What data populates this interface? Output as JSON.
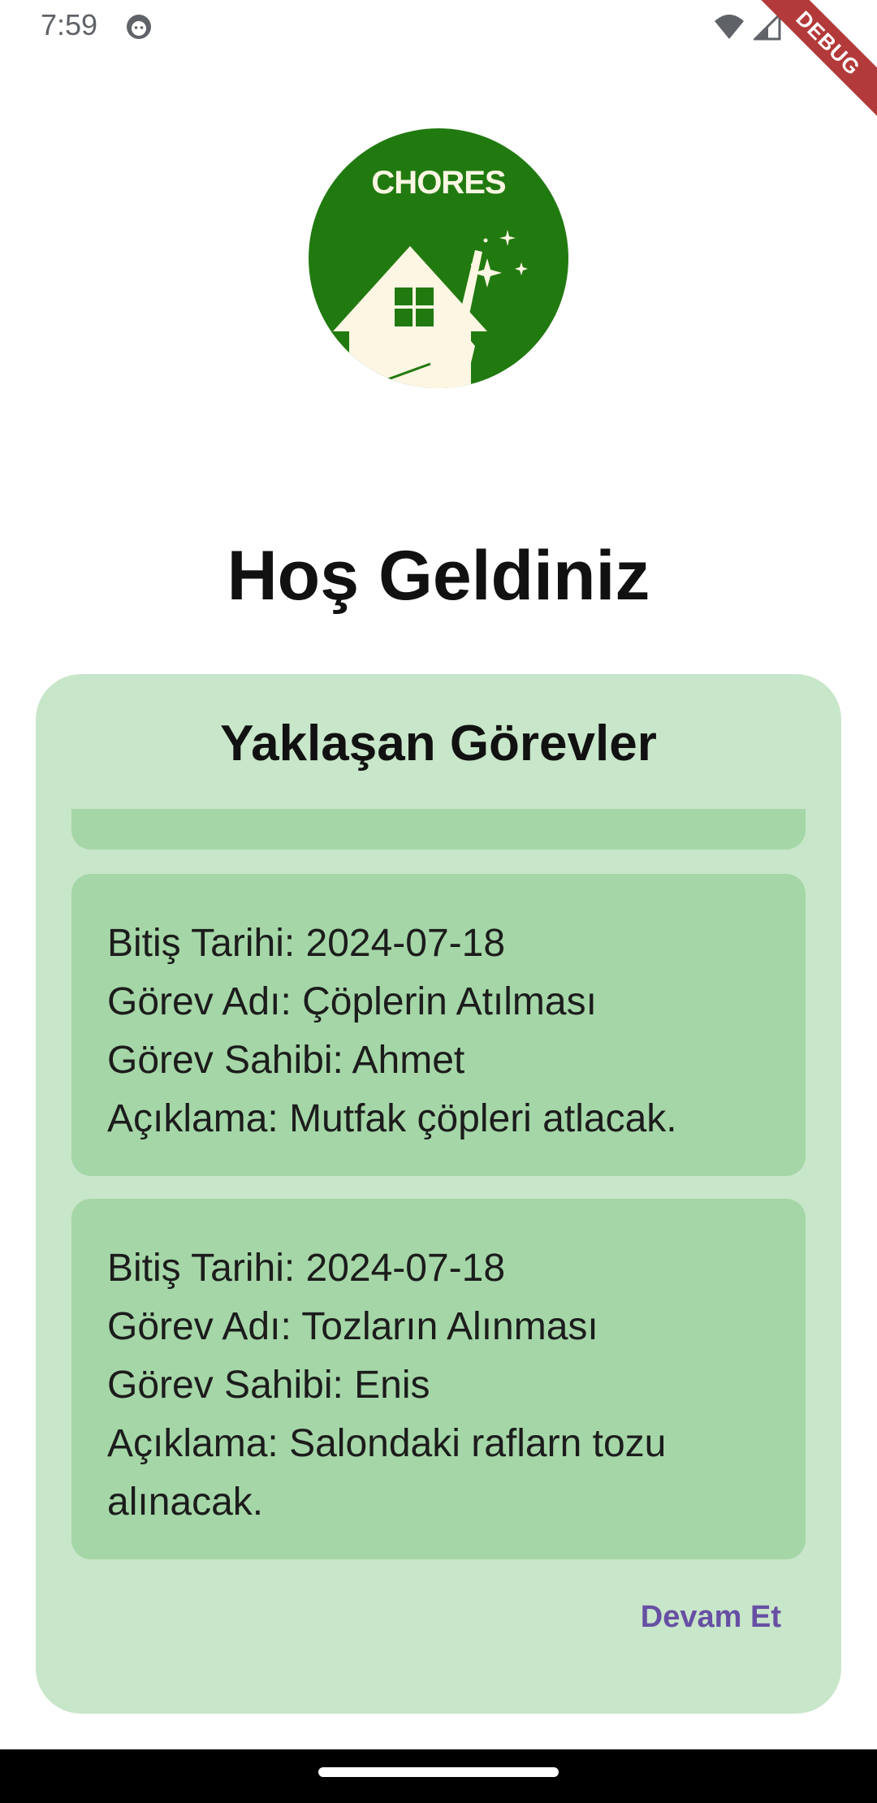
{
  "status_bar": {
    "time": "7:59",
    "icons": [
      "face-icon",
      "wifi-icon",
      "signal-icon"
    ]
  },
  "debug_banner": "DEBUG",
  "logo": {
    "text": "CHORES",
    "color": "#217a10"
  },
  "page_title": "Hoş Geldiniz",
  "upcoming": {
    "title": "Yaklaşan Görevler",
    "tasks": [
      {
        "lines": [
          "Bitiş Tarihi: 2024-07-18",
          "Görev Adı: Çöplerin Atılması",
          "Görev Sahibi: Ahmet",
          "Açıklama: Mutfak çöpleri atlacak."
        ]
      },
      {
        "lines": [
          "Bitiş Tarihi: 2024-07-18",
          "Görev Adı: Tozların Alınması",
          "Görev Sahibi: Enis",
          "Açıklama: Salondaki raflarn tozu",
          "alınacak."
        ]
      }
    ],
    "continue_label": "Devam Et"
  },
  "colors": {
    "card_bg": "#c8e6c9",
    "task_bg": "#a5d6a7",
    "accent": "#6750a4",
    "logo_green": "#217a10"
  }
}
